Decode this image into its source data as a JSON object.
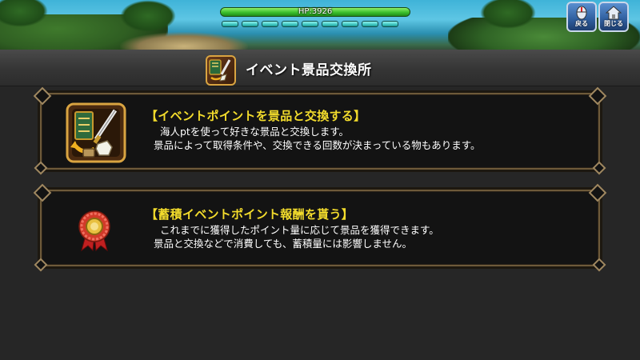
{
  "hud": {
    "hp_label": "HP:3926",
    "gauge_segments": 9
  },
  "top_buttons": {
    "back_label": "戻る",
    "close_label": "閉じる"
  },
  "screen": {
    "title": "イベント景品交換所"
  },
  "menu": {
    "items": [
      {
        "title": "【イベントポイントを景品と交換する】",
        "line1": "海人ptを使って好きな景品と交換します。",
        "line2": "景品によって取得条件や、交換できる回数が決まっている物もあります。",
        "icon": "exchange-shop-icon"
      },
      {
        "title": "【蓄積イベントポイント報酬を貰う】",
        "line1": "これまでに獲得したポイント量に応じて景品を獲得できます。",
        "line2": "景品と交換などで消費しても、蓄積量には影響しません。",
        "icon": "rosette-medal-icon"
      }
    ]
  },
  "colors": {
    "accent_gold": "#f3dc2c",
    "hp_green": "#3bbf2c",
    "gauge_cyan": "#3fc8c2",
    "card_border": "#6e5a3a"
  }
}
